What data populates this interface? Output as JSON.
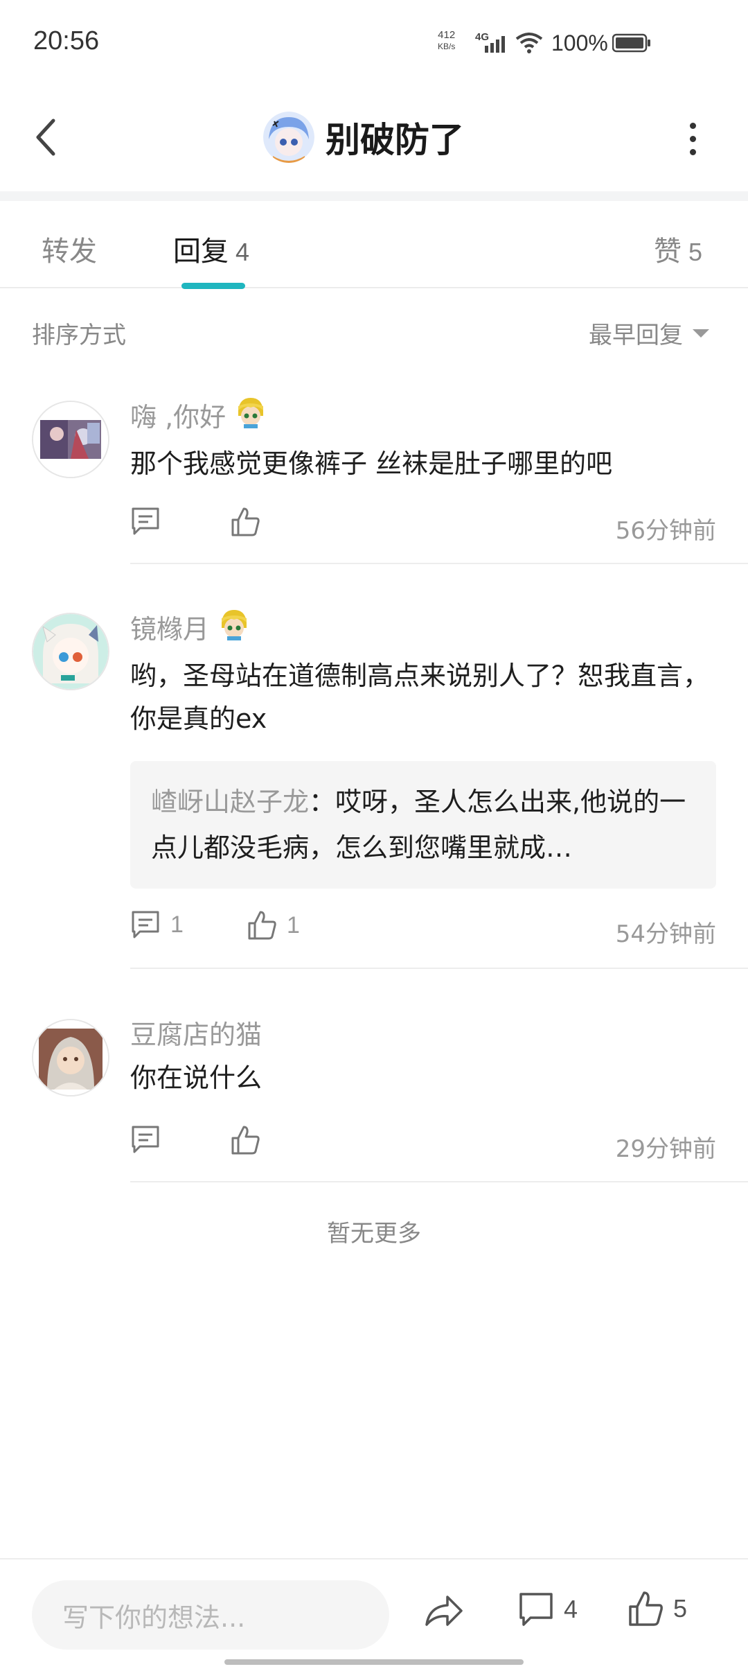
{
  "status_bar": {
    "time": "20:56",
    "net_speed_value": "412",
    "net_speed_unit": "KB/s",
    "network": "4G",
    "battery": "100%"
  },
  "header": {
    "title": "别破防了"
  },
  "tabs": {
    "forward": {
      "label": "转发"
    },
    "reply": {
      "label": "回复",
      "count": "4"
    },
    "like": {
      "label": "赞",
      "count": "5"
    }
  },
  "sort": {
    "label": "排序方式",
    "selected": "最早回复"
  },
  "comments": [
    {
      "name": "嗨 ,你好",
      "text": "那个我感觉更像裤子 丝袜是肚子哪里的吧",
      "reply_count": "",
      "like_count": "",
      "time": "56分钟前"
    },
    {
      "name": "镜橼月",
      "text": "哟，圣母站在道德制高点来说别人了？恕我直言，你是真的ex",
      "quote_name": "嵖岈山赵子龙",
      "quote_text": "：哎呀，圣人怎么出来,他说的一点儿都没毛病，怎么到您嘴里就成…",
      "reply_count": "1",
      "like_count": "1",
      "time": "54分钟前"
    },
    {
      "name": "豆腐店的猫",
      "text": "你在说什么",
      "reply_count": "",
      "like_count": "",
      "time": "29分钟前"
    }
  ],
  "footer_note": "暂无更多",
  "bottom_bar": {
    "input_placeholder": "写下你的想法...",
    "comment_count": "4",
    "like_count": "5"
  },
  "colors": {
    "accent": "#1fb6bf",
    "muted_text": "#999999",
    "primary_text": "#1e1e1e"
  }
}
